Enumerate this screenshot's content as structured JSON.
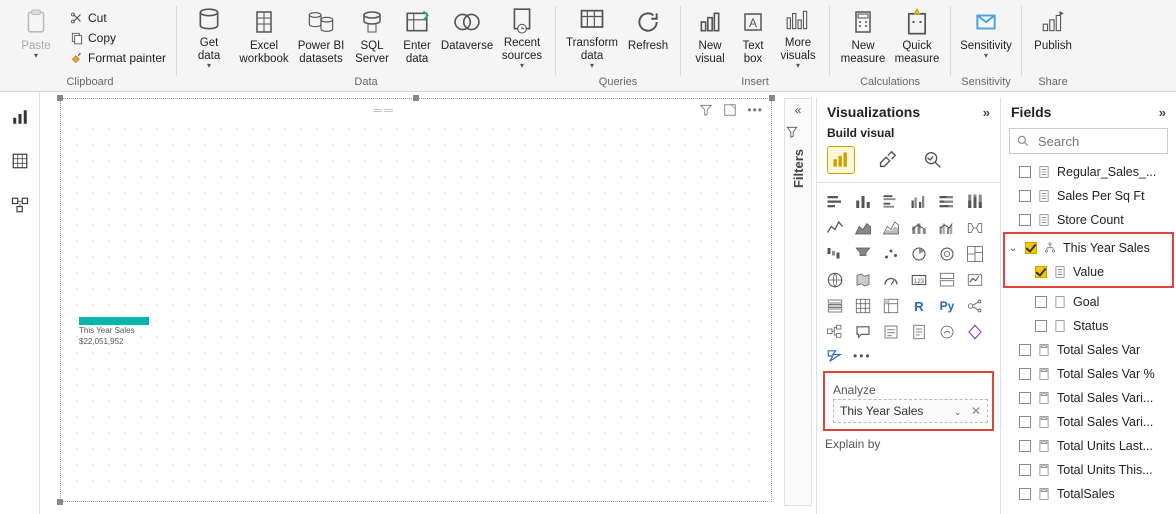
{
  "ribbon": {
    "paste": "Paste",
    "cut": "Cut",
    "copy": "Copy",
    "format_painter": "Format painter",
    "clipboard_group": "Clipboard",
    "get_data": "Get\ndata",
    "excel_wb": "Excel\nworkbook",
    "pbi_ds": "Power BI\ndatasets",
    "sql_server": "SQL\nServer",
    "enter_data": "Enter\ndata",
    "dataverse": "Dataverse",
    "recent_sources": "Recent\nsources",
    "data_group": "Data",
    "transform": "Transform\ndata",
    "refresh": "Refresh",
    "queries_group": "Queries",
    "new_visual": "New\nvisual",
    "text_box": "Text\nbox",
    "more_visuals": "More\nvisuals",
    "insert_group": "Insert",
    "new_measure": "New\nmeasure",
    "quick_measure": "Quick\nmeasure",
    "calc_group": "Calculations",
    "sensitivity": "Sensitivity",
    "sensitivity_group": "Sensitivity",
    "publish": "Publish",
    "share_group": "Share"
  },
  "filters_label": "Filters",
  "viz": {
    "title": "Visualizations",
    "sub": "Build visual",
    "analyze_label": "Analyze",
    "analyze_field": "This Year Sales",
    "explain_label": "Explain by"
  },
  "fields": {
    "title": "Fields",
    "search_placeholder": "Search",
    "items": [
      {
        "label": "Regular_Sales_...",
        "checked": false,
        "type": "col"
      },
      {
        "label": "Sales Per Sq Ft",
        "checked": false,
        "type": "col"
      },
      {
        "label": "Store Count",
        "checked": false,
        "type": "col"
      }
    ],
    "highlight_parent": "This Year Sales",
    "highlight_child": "Value",
    "after": [
      {
        "label": "Goal",
        "checked": false
      },
      {
        "label": "Status",
        "checked": false
      },
      {
        "label": "Total Sales Var",
        "checked": false
      },
      {
        "label": "Total Sales Var %",
        "checked": false
      },
      {
        "label": "Total Sales Vari...",
        "checked": false
      },
      {
        "label": "Total Sales Vari...",
        "checked": false
      },
      {
        "label": "Total Units Last...",
        "checked": false
      },
      {
        "label": "Total Units This...",
        "checked": false
      },
      {
        "label": "TotalSales",
        "checked": false
      }
    ]
  },
  "canvas_viz": {
    "label": "This Year Sales",
    "value": "$22,051,952"
  }
}
